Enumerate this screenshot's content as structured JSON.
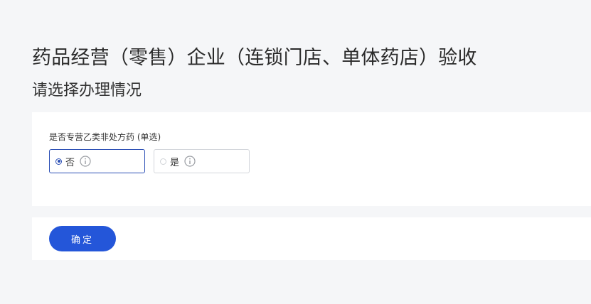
{
  "header": {
    "title": "药品经营（零售）企业（连锁门店、单体药店）验收",
    "subtitle": "请选择办理情况"
  },
  "question": {
    "label": "是否专营乙类非处方药 (单选)",
    "options": [
      {
        "label": "否",
        "selected": true,
        "icon": "info-icon"
      },
      {
        "label": "是",
        "selected": false,
        "icon": "info-icon"
      }
    ]
  },
  "actions": {
    "confirm_label": "确定"
  },
  "colors": {
    "accent": "#2456d9",
    "background": "#f5f6f8",
    "card": "#ffffff",
    "selected_border": "#2b4fb5"
  }
}
